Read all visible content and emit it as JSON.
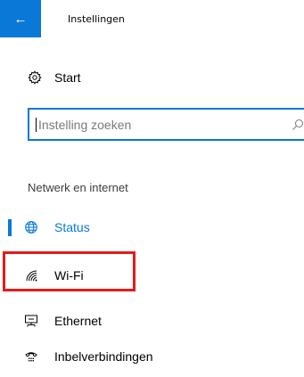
{
  "window": {
    "title": "Instellingen"
  },
  "titlebar": {
    "back_glyph": "←"
  },
  "home": {
    "label": "Start",
    "icon": "gear-icon"
  },
  "search": {
    "placeholder": "Instelling zoeken",
    "icon": "search-icon"
  },
  "section": {
    "header": "Netwerk en internet"
  },
  "nav": {
    "items": [
      {
        "label": "Status",
        "icon": "globe-icon",
        "selected": true
      },
      {
        "label": "Wi-Fi",
        "icon": "wifi-icon",
        "selected": false
      },
      {
        "label": "Ethernet",
        "icon": "ethernet-icon",
        "selected": false
      },
      {
        "label": "Inbelverbindingen",
        "icon": "dialup-icon",
        "selected": false
      }
    ]
  },
  "colors": {
    "accent": "#0a78d7",
    "highlight": "#e31b1b",
    "placeholder": "#7a7a7a"
  }
}
